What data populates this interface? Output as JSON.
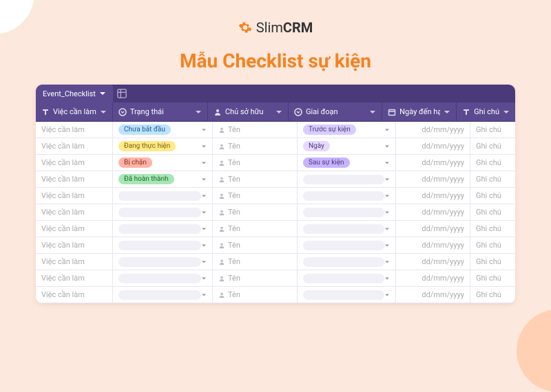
{
  "brand": {
    "name_light": "Slim",
    "name_bold": "CRM"
  },
  "page_title": "Mẫu Checklist sự kiện",
  "tab": {
    "name": "Event_Checklist"
  },
  "columns": {
    "task": "Việc cần làm",
    "status": "Trạng thái",
    "owner": "Chủ sở hữu",
    "phase": "Giai đoạn",
    "date": "Ngày đến hạn",
    "note": "Ghi chú"
  },
  "placeholders": {
    "task": "Việc cần làm",
    "owner": "Tên",
    "date": "dd/mm/yyyy",
    "note": "Ghi chú"
  },
  "status_options": [
    {
      "label": "Chưa bắt đầu",
      "class": "p-blue"
    },
    {
      "label": "Đang thực hiện",
      "class": "p-yellow"
    },
    {
      "label": "Bị chặn",
      "class": "p-red"
    },
    {
      "label": "Đã hoàn thành",
      "class": "p-green"
    }
  ],
  "phase_options": [
    {
      "label": "Trước sự kiện",
      "class": "p-lavender"
    },
    {
      "label": "Ngày",
      "class": "p-lilac"
    },
    {
      "label": "Sau sự kiện",
      "class": "p-violet"
    }
  ],
  "rows": [
    {
      "status_idx": 0,
      "phase_idx": 0
    },
    {
      "status_idx": 1,
      "phase_idx": 1
    },
    {
      "status_idx": 2,
      "phase_idx": 2
    },
    {
      "status_idx": 3,
      "phase_idx": null
    },
    {
      "status_idx": null,
      "phase_idx": null
    },
    {
      "status_idx": null,
      "phase_idx": null
    },
    {
      "status_idx": null,
      "phase_idx": null
    },
    {
      "status_idx": null,
      "phase_idx": null
    },
    {
      "status_idx": null,
      "phase_idx": null
    },
    {
      "status_idx": null,
      "phase_idx": null
    },
    {
      "status_idx": null,
      "phase_idx": null
    }
  ]
}
